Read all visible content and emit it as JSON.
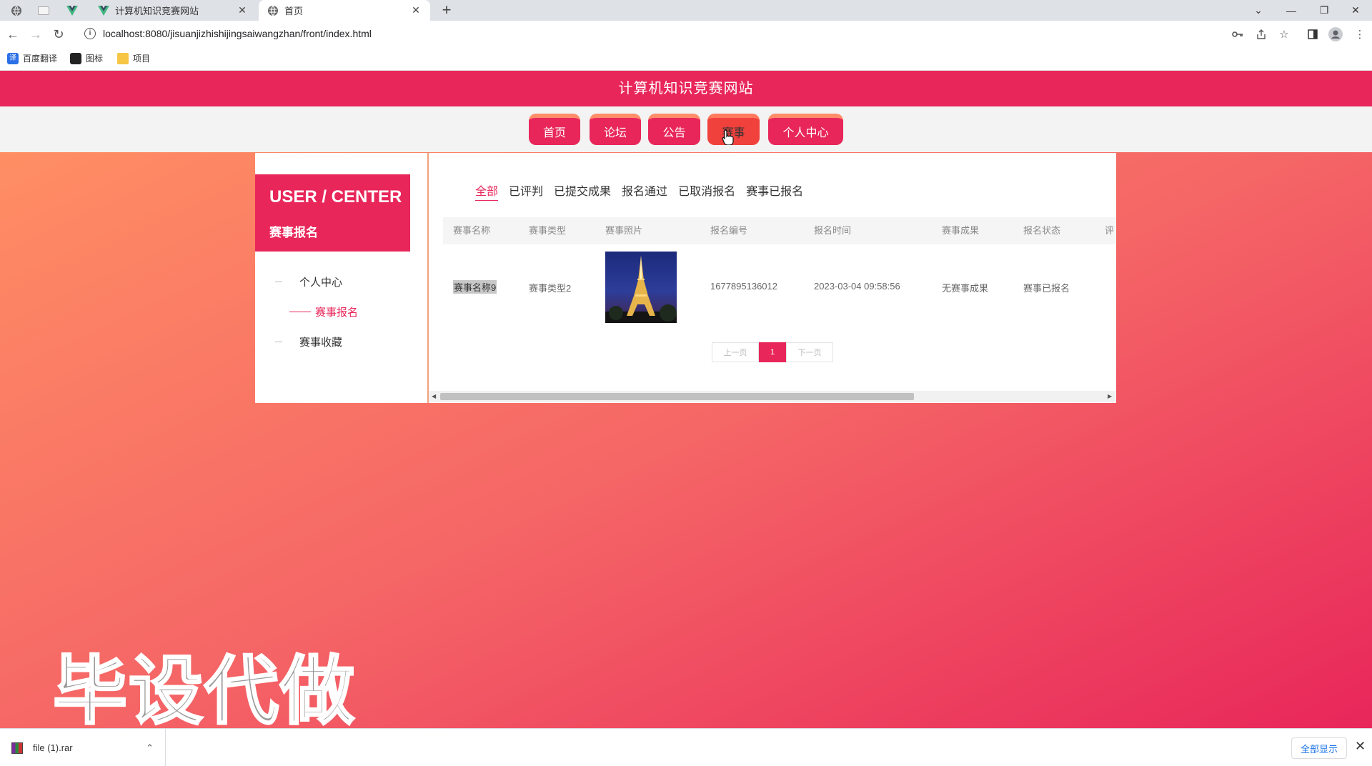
{
  "browser": {
    "tabs": [
      {
        "title": "计算机知识竞赛网站",
        "active": false
      },
      {
        "title": "首页",
        "active": true
      }
    ],
    "new_tab": "+",
    "url": "localhost:8080/jisuanjizhishijingsaiwangzhan/front/index.html",
    "bookmarks": [
      "百度翻译",
      "图标",
      "项目"
    ],
    "window_controls": [
      "⌄",
      "—",
      "❐",
      "✕"
    ]
  },
  "site": {
    "title": "计算机知识竞赛网站",
    "nav": [
      "首页",
      "论坛",
      "公告",
      "赛事",
      "个人中心"
    ]
  },
  "sidebar": {
    "heading_en": "USER / CENTER",
    "heading_cn": "赛事报名",
    "items": [
      {
        "label": "个人中心",
        "active": false
      },
      {
        "label": "赛事报名",
        "active": true
      },
      {
        "label": "赛事收藏",
        "active": false
      }
    ]
  },
  "filters": [
    "全部",
    "已评判",
    "已提交成果",
    "报名通过",
    "已取消报名",
    "赛事已报名"
  ],
  "table": {
    "columns": [
      "赛事名称",
      "赛事类型",
      "赛事照片",
      "报名编号",
      "报名时间",
      "赛事成果",
      "报名状态",
      "评"
    ],
    "rows": [
      {
        "name": "赛事名称9",
        "type": "赛事类型2",
        "photo": "eiffel-tower-photo",
        "signup_no": "1677895136012",
        "signup_time": "2023-03-04 09:58:56",
        "result": "无赛事成果",
        "status": "赛事已报名"
      }
    ]
  },
  "pagination": {
    "prev": "上一页",
    "current": "1",
    "next": "下一页"
  },
  "watermark": "毕设代做",
  "downloads": {
    "file": "file (1).rar",
    "show_all": "全部显示"
  },
  "colors": {
    "brand": "#e8265a",
    "accent": "#ff8d6a",
    "bg_gradient_start": "#ff8e64",
    "bg_gradient_end": "#e8265a"
  }
}
